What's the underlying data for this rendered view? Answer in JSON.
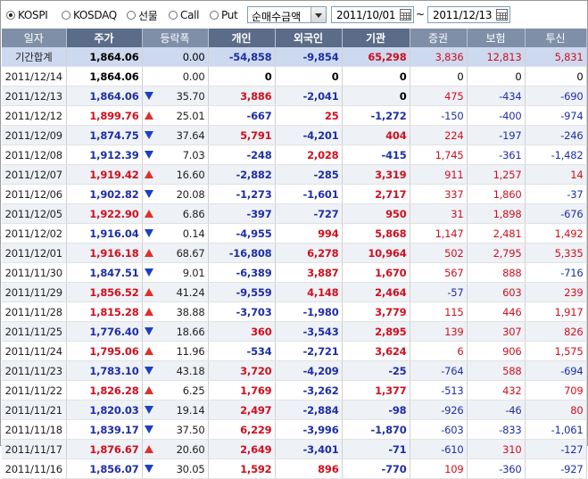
{
  "toolbar": {
    "markets": [
      {
        "label": "KOSPI",
        "selected": true
      },
      {
        "label": "KOSDAQ",
        "selected": false
      },
      {
        "label": "선물",
        "selected": false
      },
      {
        "label": "Call",
        "selected": false
      },
      {
        "label": "Put",
        "selected": false
      }
    ],
    "metric": "순매수금액",
    "date_from": "2011/10/01",
    "tilde": "~",
    "date_to": "2011/12/13"
  },
  "columns": [
    "일자",
    "주가",
    "등락폭",
    "개인",
    "외국인",
    "기관",
    "증권",
    "보험",
    "투신"
  ],
  "summary": {
    "date": "기간합계",
    "price": "1,864.06",
    "change": "0.00",
    "individual": "-54,858",
    "foreign": "-9,854",
    "institution": "65,298",
    "securities": "3,836",
    "insurance": "12,813",
    "trust": "5,831"
  },
  "rows": [
    {
      "date": "2011/12/14",
      "price": "1,864.06",
      "dir": "none",
      "change": "0.00",
      "individual": "0",
      "foreign": "0",
      "institution": "0",
      "securities": "0",
      "insurance": "0",
      "trust": "0"
    },
    {
      "date": "2011/12/13",
      "price": "1,864.06",
      "dir": "down",
      "change": "35.70",
      "individual": "3,886",
      "foreign": "-2,041",
      "institution": "0",
      "securities": "475",
      "insurance": "-434",
      "trust": "-690"
    },
    {
      "date": "2011/12/12",
      "price": "1,899.76",
      "dir": "up",
      "change": "25.01",
      "individual": "-667",
      "foreign": "25",
      "institution": "-1,272",
      "securities": "-150",
      "insurance": "-400",
      "trust": "-974"
    },
    {
      "date": "2011/12/09",
      "price": "1,874.75",
      "dir": "down",
      "change": "37.64",
      "individual": "5,791",
      "foreign": "-4,201",
      "institution": "404",
      "securities": "224",
      "insurance": "-197",
      "trust": "-246"
    },
    {
      "date": "2011/12/08",
      "price": "1,912.39",
      "dir": "down",
      "change": "7.03",
      "individual": "-248",
      "foreign": "2,028",
      "institution": "-415",
      "securities": "1,745",
      "insurance": "-361",
      "trust": "-1,482"
    },
    {
      "date": "2011/12/07",
      "price": "1,919.42",
      "dir": "up",
      "change": "16.60",
      "individual": "-2,882",
      "foreign": "-285",
      "institution": "3,319",
      "securities": "911",
      "insurance": "1,257",
      "trust": "14"
    },
    {
      "date": "2011/12/06",
      "price": "1,902.82",
      "dir": "down",
      "change": "20.08",
      "individual": "-1,273",
      "foreign": "-1,601",
      "institution": "2,717",
      "securities": "337",
      "insurance": "1,860",
      "trust": "-37"
    },
    {
      "date": "2011/12/05",
      "price": "1,922.90",
      "dir": "up",
      "change": "6.86",
      "individual": "-397",
      "foreign": "-727",
      "institution": "950",
      "securities": "31",
      "insurance": "1,898",
      "trust": "-676"
    },
    {
      "date": "2011/12/02",
      "price": "1,916.04",
      "dir": "down",
      "change": "0.14",
      "individual": "-4,955",
      "foreign": "994",
      "institution": "5,868",
      "securities": "1,147",
      "insurance": "2,481",
      "trust": "1,492"
    },
    {
      "date": "2011/12/01",
      "price": "1,916.18",
      "dir": "up",
      "change": "68.67",
      "individual": "-16,808",
      "foreign": "6,278",
      "institution": "10,964",
      "securities": "502",
      "insurance": "2,795",
      "trust": "5,335"
    },
    {
      "date": "2011/11/30",
      "price": "1,847.51",
      "dir": "down",
      "change": "9.01",
      "individual": "-6,389",
      "foreign": "3,887",
      "institution": "1,670",
      "securities": "567",
      "insurance": "888",
      "trust": "-716"
    },
    {
      "date": "2011/11/29",
      "price": "1,856.52",
      "dir": "up",
      "change": "41.24",
      "individual": "-9,559",
      "foreign": "4,148",
      "institution": "2,464",
      "securities": "-57",
      "insurance": "603",
      "trust": "239"
    },
    {
      "date": "2011/11/28",
      "price": "1,815.28",
      "dir": "up",
      "change": "38.88",
      "individual": "-3,703",
      "foreign": "-1,980",
      "institution": "3,779",
      "securities": "115",
      "insurance": "446",
      "trust": "1,917"
    },
    {
      "date": "2011/11/25",
      "price": "1,776.40",
      "dir": "down",
      "change": "18.66",
      "individual": "360",
      "foreign": "-3,543",
      "institution": "2,895",
      "securities": "139",
      "insurance": "307",
      "trust": "826"
    },
    {
      "date": "2011/11/24",
      "price": "1,795.06",
      "dir": "up",
      "change": "11.96",
      "individual": "-534",
      "foreign": "-2,721",
      "institution": "3,624",
      "securities": "6",
      "insurance": "906",
      "trust": "1,575"
    },
    {
      "date": "2011/11/23",
      "price": "1,783.10",
      "dir": "down",
      "change": "43.18",
      "individual": "3,720",
      "foreign": "-4,209",
      "institution": "-25",
      "securities": "-764",
      "insurance": "588",
      "trust": "-694"
    },
    {
      "date": "2011/11/22",
      "price": "1,826.28",
      "dir": "up",
      "change": "6.25",
      "individual": "1,769",
      "foreign": "-3,262",
      "institution": "1,377",
      "securities": "-513",
      "insurance": "432",
      "trust": "709"
    },
    {
      "date": "2011/11/21",
      "price": "1,820.03",
      "dir": "down",
      "change": "19.14",
      "individual": "2,497",
      "foreign": "-2,884",
      "institution": "-98",
      "securities": "-926",
      "insurance": "-46",
      "trust": "80"
    },
    {
      "date": "2011/11/18",
      "price": "1,839.17",
      "dir": "down",
      "change": "37.50",
      "individual": "6,229",
      "foreign": "-3,996",
      "institution": "-1,870",
      "securities": "-603",
      "insurance": "-833",
      "trust": "-1,061"
    },
    {
      "date": "2011/11/17",
      "price": "1,876.67",
      "dir": "up",
      "change": "20.60",
      "individual": "2,649",
      "foreign": "-3,401",
      "institution": "-71",
      "securities": "-610",
      "insurance": "310",
      "trust": "-127"
    },
    {
      "date": "2011/11/16",
      "price": "1,856.07",
      "dir": "down",
      "change": "30.05",
      "individual": "1,592",
      "foreign": "896",
      "institution": "-770",
      "securities": "109",
      "insurance": "-360",
      "trust": "-927"
    }
  ],
  "colors": {
    "up": "#d0101e",
    "down": "#1f2fa6",
    "header": "#7f8fa8",
    "header_highlight": "#5b6c88",
    "summary_row": "#cdd9ef",
    "alt_row": "#eef1f6"
  }
}
